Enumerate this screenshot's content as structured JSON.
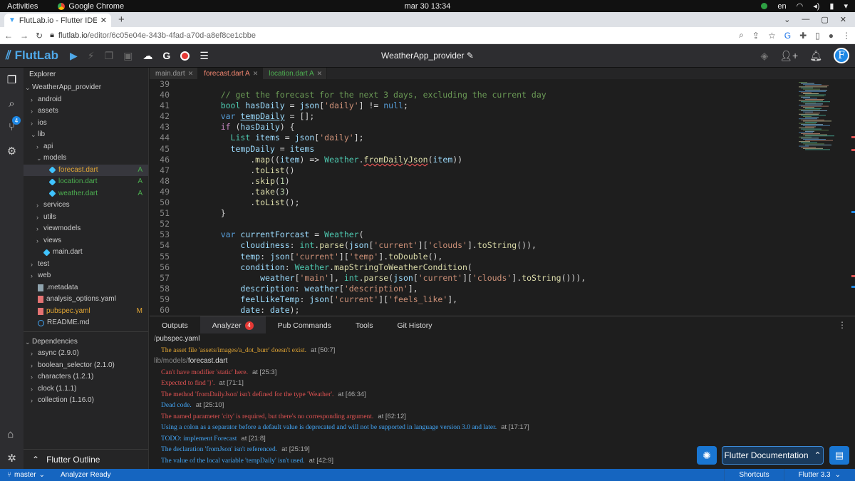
{
  "os": {
    "activities": "Activities",
    "app_name": "Google Chrome",
    "clock": "mar 30  13:34",
    "lang": "en"
  },
  "browser": {
    "tab_title": "FlutLab.io - Flutter IDE on",
    "url_domain": "flutlab.io",
    "url_path": "/editor/6c05e04e-343b-4fad-a70d-a8ef8ce1cbbe"
  },
  "app": {
    "logo": "FlutLab",
    "project": "WeatherApp_provider",
    "avatar_letter": "F",
    "accent": "#1e88e5"
  },
  "activity": {
    "git_badge": "4"
  },
  "explorer": {
    "title": "Explorer",
    "rows": [
      {
        "label": "WeatherApp_provider",
        "caret": "⌄",
        "indent": 0
      },
      {
        "label": "android",
        "caret": "›",
        "indent": 1
      },
      {
        "label": "assets",
        "caret": "›",
        "indent": 1
      },
      {
        "label": "ios",
        "caret": "›",
        "indent": 1
      },
      {
        "label": "lib",
        "caret": "⌄",
        "indent": 1
      },
      {
        "label": "api",
        "caret": "›",
        "indent": 2
      },
      {
        "label": "models",
        "caret": "⌄",
        "indent": 2
      },
      {
        "label": "forecast.dart",
        "file": "dart",
        "indent": 3,
        "status": "A",
        "sel": true,
        "color": "orange"
      },
      {
        "label": "location.dart",
        "file": "dart",
        "indent": 3,
        "status": "A",
        "color": "green"
      },
      {
        "label": "weather.dart",
        "file": "dart",
        "indent": 3,
        "status": "A",
        "color": "green"
      },
      {
        "label": "services",
        "caret": "›",
        "indent": 2
      },
      {
        "label": "utils",
        "caret": "›",
        "indent": 2
      },
      {
        "label": "viewmodels",
        "caret": "›",
        "indent": 2
      },
      {
        "label": "views",
        "caret": "›",
        "indent": 2
      },
      {
        "label": "main.dart",
        "file": "dart",
        "indent": 2
      },
      {
        "label": "test",
        "caret": "›",
        "indent": 1
      },
      {
        "label": "web",
        "caret": "›",
        "indent": 1
      },
      {
        "label": ".metadata",
        "file": "plain",
        "indent": 1
      },
      {
        "label": "analysis_options.yaml",
        "file": "yaml",
        "indent": 1
      },
      {
        "label": "pubspec.yaml",
        "file": "yaml",
        "indent": 1,
        "status": "M",
        "color": "orange"
      },
      {
        "label": "README.md",
        "file": "info",
        "indent": 1
      }
    ],
    "deps_title": "Dependencies",
    "deps": [
      "async (2.9.0)",
      "boolean_selector (2.1.0)",
      "characters (1.2.1)",
      "clock (1.1.1)",
      "collection (1.16.0)"
    ],
    "outline": "Flutter Outline"
  },
  "editor": {
    "tabs": [
      {
        "label": "main.dart",
        "cls": ""
      },
      {
        "label": "forecast.dart A",
        "cls": "active"
      },
      {
        "label": "location.dart A",
        "cls": "loc"
      }
    ],
    "lines": [
      {
        "n": "39",
        "html": ""
      },
      {
        "n": "40",
        "html": "    <span style='color:#6a9955'>// get the forecast for the next 3 days, excluding the current day</span>"
      },
      {
        "n": "41",
        "html": "    <span style='color:#4ec9b0'>bool</span> <span style='color:#9cdcfe'>hasDaily</span> = <span style='color:#9cdcfe'>json</span>[<span style='color:#ce9178'>'daily'</span>] != <span style='color:#569cd6'>null</span>;"
      },
      {
        "n": "42",
        "html": "    <span style='color:#569cd6'>var</span> <span style='color:#9cdcfe;text-decoration:underline'>tempDaily</span> = [];"
      },
      {
        "n": "43",
        "html": "    <span style='color:#c586c0'>if</span> (<span style='color:#9cdcfe'>hasDaily</span>) {"
      },
      {
        "n": "44",
        "html": "      <span style='color:#4ec9b0'>List</span> <span style='color:#9cdcfe'>items</span> = <span style='color:#9cdcfe'>json</span>[<span style='color:#ce9178'>'daily'</span>];"
      },
      {
        "n": "45",
        "html": "      <span style='color:#9cdcfe'>tempDaily</span> = <span style='color:#9cdcfe'>items</span>"
      },
      {
        "n": "46",
        "html": "          .<span style='color:#dcdcaa'>map</span>((<span style='color:#9cdcfe'>item</span>) => <span style='color:#4ec9b0'>Weather</span>.<span style='color:#dcdcaa;text-decoration:underline wavy #e05252'>fromDailyJson</span>(<span style='color:#9cdcfe'>item</span>))"
      },
      {
        "n": "47",
        "html": "          .<span style='color:#dcdcaa'>toList</span>()"
      },
      {
        "n": "48",
        "html": "          .<span style='color:#dcdcaa'>skip</span>(<span style='color:#b5cea8'>1</span>)"
      },
      {
        "n": "49",
        "html": "          .<span style='color:#dcdcaa'>take</span>(<span style='color:#b5cea8'>3</span>)"
      },
      {
        "n": "50",
        "html": "          .<span style='color:#dcdcaa'>toList</span>();"
      },
      {
        "n": "51",
        "html": "    }"
      },
      {
        "n": "52",
        "html": ""
      },
      {
        "n": "53",
        "html": "    <span style='color:#569cd6'>var</span> <span style='color:#9cdcfe'>currentForcast</span> = <span style='color:#4ec9b0'>Weather</span>("
      },
      {
        "n": "54",
        "html": "        <span style='color:#9cdcfe'>cloudiness</span>: <span style='color:#4ec9b0'>int</span>.<span style='color:#dcdcaa'>parse</span>(<span style='color:#9cdcfe'>json</span>[<span style='color:#ce9178'>'current'</span>][<span style='color:#ce9178'>'clouds'</span>].<span style='color:#dcdcaa'>toString</span>()),"
      },
      {
        "n": "55",
        "html": "        <span style='color:#9cdcfe'>temp</span>: <span style='color:#9cdcfe'>json</span>[<span style='color:#ce9178'>'current'</span>][<span style='color:#ce9178'>'temp'</span>].<span style='color:#dcdcaa'>toDouble</span>(),"
      },
      {
        "n": "56",
        "html": "        <span style='color:#9cdcfe'>condition</span>: <span style='color:#4ec9b0'>Weather</span>.<span style='color:#dcdcaa'>mapStringToWeatherCondition</span>("
      },
      {
        "n": "57",
        "html": "            <span style='color:#9cdcfe'>weather</span>[<span style='color:#ce9178'>'main'</span>], <span style='color:#4ec9b0'>int</span>.<span style='color:#dcdcaa'>parse</span>(<span style='color:#9cdcfe'>json</span>[<span style='color:#ce9178'>'current'</span>][<span style='color:#ce9178'>'clouds'</span>].<span style='color:#dcdcaa'>toString</span>())),"
      },
      {
        "n": "58",
        "html": "        <span style='color:#9cdcfe'>description</span>: <span style='color:#9cdcfe'>weather</span>[<span style='color:#ce9178'>'description'</span>],"
      },
      {
        "n": "59",
        "html": "        <span style='color:#9cdcfe'>feelLikeTemp</span>: <span style='color:#9cdcfe'>json</span>[<span style='color:#ce9178'>'current'</span>][<span style='color:#ce9178'>'feels_like'</span>],"
      },
      {
        "n": "60",
        "html": "        <span style='color:#9cdcfe'>date</span>: <span style='color:#9cdcfe'>date</span>);"
      }
    ]
  },
  "panel": {
    "tabs": [
      {
        "label": "Outputs",
        "active": false
      },
      {
        "label": "Analyzer",
        "active": true,
        "badge": "4"
      },
      {
        "label": "Pub Commands",
        "active": false
      },
      {
        "label": "Tools",
        "active": false
      },
      {
        "label": "Git History",
        "active": false
      }
    ],
    "groups": [
      {
        "dir": "/",
        "file": "pubspec.yaml",
        "items": [
          {
            "text": "The asset file 'assets/images/a_dot_burr' doesn't exist.",
            "at": "at  [50:7]",
            "sev": "warn"
          }
        ]
      },
      {
        "dir": "lib/models/",
        "file": "forecast.dart",
        "items": [
          {
            "text": "Can't have modifier 'static' here.",
            "at": "at  [25:3]",
            "sev": "err"
          },
          {
            "text": "Expected to find '}'.",
            "at": "at  [71:1]",
            "sev": "err"
          },
          {
            "text": "The method 'fromDailyJson' isn't defined for the type 'Weather'.",
            "at": "at  [46:34]",
            "sev": "err"
          },
          {
            "text": "Dead code.",
            "at": "at  [25:10]",
            "sev": "info"
          },
          {
            "text": "The named parameter 'city' is required, but there's no corresponding argument.",
            "at": "at  [62:12]",
            "sev": "err"
          },
          {
            "text": "Using a colon as a separator before a default value is deprecated and will not be supported in language version 3.0 and later.",
            "at": "at  [17:17]",
            "sev": "info"
          },
          {
            "text": "TODO: implement Forecast",
            "at": "at  [21:8]",
            "sev": "info"
          },
          {
            "text": "The declaration 'fromJson' isn't referenced.",
            "at": "at  [25:19]",
            "sev": "info"
          },
          {
            "text": "The value of the local variable 'tempDaily' isn't used.",
            "at": "at  [42:9]",
            "sev": "info"
          }
        ]
      }
    ]
  },
  "fab": {
    "docs": "Flutter Documentation"
  },
  "status": {
    "branch": "master",
    "analyzer": "Analyzer Ready",
    "shortcuts": "Shortcuts",
    "flutter": "Flutter 3.3"
  }
}
